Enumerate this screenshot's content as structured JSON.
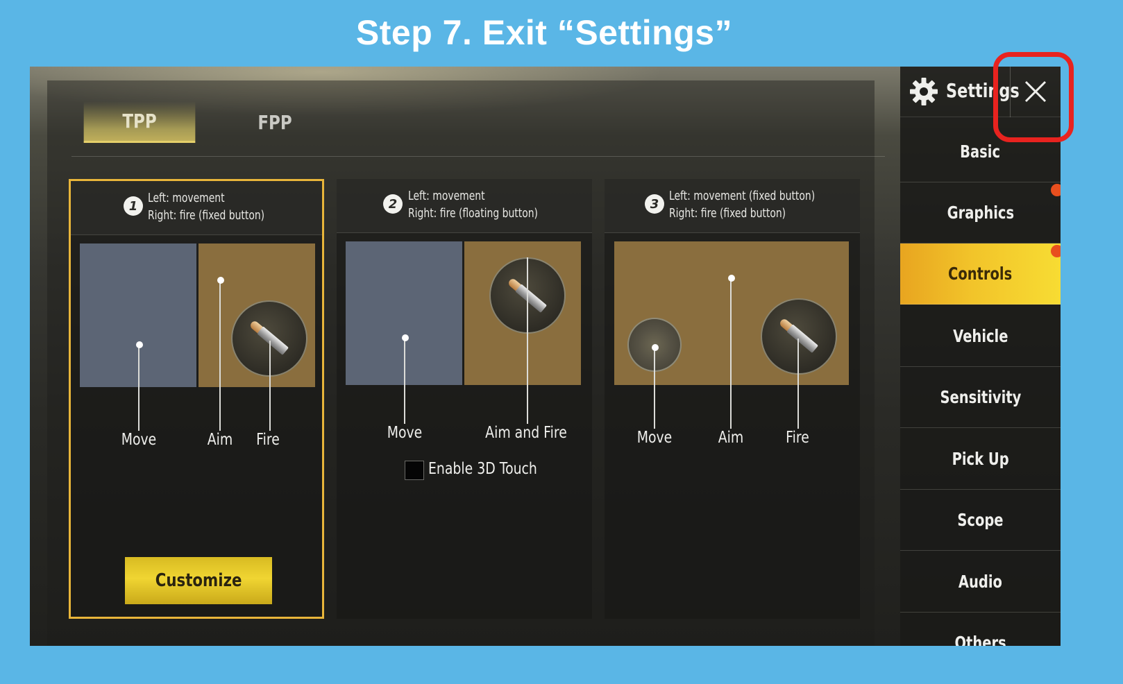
{
  "step_title": "Step 7. Exit “Settings”",
  "tabs": [
    {
      "label": "TPP",
      "selected": true
    },
    {
      "label": "FPP",
      "selected": false
    }
  ],
  "layouts": [
    {
      "number": "1",
      "line1": "Left: movement",
      "line2": "Right: fire (fixed button)",
      "labels": [
        "Move",
        "Aim",
        "Fire"
      ],
      "selected": true,
      "button": "Customize"
    },
    {
      "number": "2",
      "line1": "Left: movement",
      "line2": "Right: fire (floating button)",
      "labels": [
        "Move",
        "Aim and Fire"
      ],
      "checkbox_label": "Enable 3D Touch",
      "checkbox_checked": false
    },
    {
      "number": "3",
      "line1": "Left: movement (fixed button)",
      "line2": "Right: fire (fixed button)",
      "labels": [
        "Move",
        "Aim",
        "Fire"
      ]
    }
  ],
  "sidebar": {
    "title": "Settings",
    "close_icon": "close-icon",
    "items": [
      {
        "label": "Basic",
        "active": false,
        "notification": false
      },
      {
        "label": "Graphics",
        "active": false,
        "notification": true
      },
      {
        "label": "Controls",
        "active": true,
        "notification": true
      },
      {
        "label": "Vehicle",
        "active": false,
        "notification": false
      },
      {
        "label": "Sensitivity",
        "active": false,
        "notification": false
      },
      {
        "label": "Pick Up",
        "active": false,
        "notification": false
      },
      {
        "label": "Scope",
        "active": false,
        "notification": false
      },
      {
        "label": "Audio",
        "active": false,
        "notification": false
      },
      {
        "label": "Others",
        "active": false,
        "notification": false
      }
    ]
  },
  "colors": {
    "background": "#5ab6e6",
    "accent_yellow": "#f2c42a",
    "selected_border": "#e8b53a",
    "highlight_red": "#e8231f",
    "notification": "#e84f1e"
  }
}
